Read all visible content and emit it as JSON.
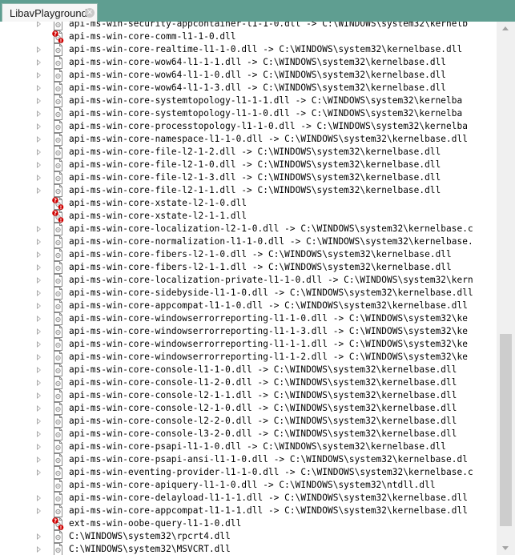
{
  "tab": {
    "title": "LibavPlayground",
    "close_glyph": "×"
  },
  "tree": {
    "items": [
      {
        "text": "api-ms-win-security-appcontainer-l1-1-0.dll -> C:\\WINDOWS\\system32\\kernelb",
        "icon": "dll-icon",
        "expandable": true
      },
      {
        "text": "api-ms-win-core-comm-l1-1-0.dll",
        "icon": "missing-dll-icon",
        "expandable": false
      },
      {
        "text": "api-ms-win-core-realtime-l1-1-0.dll -> C:\\WINDOWS\\system32\\kernelbase.dll",
        "icon": "dll-icon",
        "expandable": true
      },
      {
        "text": "api-ms-win-core-wow64-l1-1-1.dll -> C:\\WINDOWS\\system32\\kernelbase.dll",
        "icon": "dll-icon",
        "expandable": true
      },
      {
        "text": "api-ms-win-core-wow64-l1-1-0.dll -> C:\\WINDOWS\\system32\\kernelbase.dll",
        "icon": "dll-icon",
        "expandable": true
      },
      {
        "text": "api-ms-win-core-wow64-l1-1-3.dll -> C:\\WINDOWS\\system32\\kernelbase.dll",
        "icon": "dll-icon",
        "expandable": true
      },
      {
        "text": "api-ms-win-core-systemtopology-l1-1-1.dll -> C:\\WINDOWS\\system32\\kernelba",
        "icon": "dll-icon",
        "expandable": true
      },
      {
        "text": "api-ms-win-core-systemtopology-l1-1-0.dll -> C:\\WINDOWS\\system32\\kernelba",
        "icon": "dll-icon",
        "expandable": true
      },
      {
        "text": "api-ms-win-core-processtopology-l1-1-0.dll -> C:\\WINDOWS\\system32\\kernelba",
        "icon": "dll-icon",
        "expandable": true
      },
      {
        "text": "api-ms-win-core-namespace-l1-1-0.dll -> C:\\WINDOWS\\system32\\kernelbase.dll",
        "icon": "dll-icon",
        "expandable": true
      },
      {
        "text": "api-ms-win-core-file-l2-1-2.dll -> C:\\WINDOWS\\system32\\kernelbase.dll",
        "icon": "dll-icon",
        "expandable": true
      },
      {
        "text": "api-ms-win-core-file-l2-1-0.dll -> C:\\WINDOWS\\system32\\kernelbase.dll",
        "icon": "dll-icon",
        "expandable": true
      },
      {
        "text": "api-ms-win-core-file-l2-1-3.dll -> C:\\WINDOWS\\system32\\kernelbase.dll",
        "icon": "dll-icon",
        "expandable": true
      },
      {
        "text": "api-ms-win-core-file-l2-1-1.dll -> C:\\WINDOWS\\system32\\kernelbase.dll",
        "icon": "dll-icon",
        "expandable": true
      },
      {
        "text": "api-ms-win-core-xstate-l2-1-0.dll",
        "icon": "missing-dll-icon",
        "expandable": false
      },
      {
        "text": "api-ms-win-core-xstate-l2-1-1.dll",
        "icon": "missing-dll-icon",
        "expandable": false
      },
      {
        "text": "api-ms-win-core-localization-l2-1-0.dll -> C:\\WINDOWS\\system32\\kernelbase.c",
        "icon": "dll-icon",
        "expandable": true
      },
      {
        "text": "api-ms-win-core-normalization-l1-1-0.dll -> C:\\WINDOWS\\system32\\kernelbase.",
        "icon": "dll-icon",
        "expandable": true
      },
      {
        "text": "api-ms-win-core-fibers-l2-1-0.dll -> C:\\WINDOWS\\system32\\kernelbase.dll",
        "icon": "dll-icon",
        "expandable": true
      },
      {
        "text": "api-ms-win-core-fibers-l2-1-1.dll -> C:\\WINDOWS\\system32\\kernelbase.dll",
        "icon": "dll-icon",
        "expandable": true
      },
      {
        "text": "api-ms-win-core-localization-private-l1-1-0.dll -> C:\\WINDOWS\\system32\\kern",
        "icon": "dll-icon",
        "expandable": true
      },
      {
        "text": "api-ms-win-core-sidebyside-l1-1-0.dll -> C:\\WINDOWS\\system32\\kernelbase.dll",
        "icon": "dll-icon",
        "expandable": true
      },
      {
        "text": "api-ms-win-core-appcompat-l1-1-0.dll -> C:\\WINDOWS\\system32\\kernelbase.dll",
        "icon": "dll-icon",
        "expandable": true
      },
      {
        "text": "api-ms-win-core-windowserrorreporting-l1-1-0.dll -> C:\\WINDOWS\\system32\\ke",
        "icon": "dll-icon",
        "expandable": true
      },
      {
        "text": "api-ms-win-core-windowserrorreporting-l1-1-3.dll -> C:\\WINDOWS\\system32\\ke",
        "icon": "dll-icon",
        "expandable": true
      },
      {
        "text": "api-ms-win-core-windowserrorreporting-l1-1-1.dll -> C:\\WINDOWS\\system32\\ke",
        "icon": "dll-icon",
        "expandable": true
      },
      {
        "text": "api-ms-win-core-windowserrorreporting-l1-1-2.dll -> C:\\WINDOWS\\system32\\ke",
        "icon": "dll-icon",
        "expandable": true
      },
      {
        "text": "api-ms-win-core-console-l1-1-0.dll -> C:\\WINDOWS\\system32\\kernelbase.dll",
        "icon": "dll-icon",
        "expandable": true
      },
      {
        "text": "api-ms-win-core-console-l1-2-0.dll -> C:\\WINDOWS\\system32\\kernelbase.dll",
        "icon": "dll-icon",
        "expandable": true
      },
      {
        "text": "api-ms-win-core-console-l2-1-1.dll -> C:\\WINDOWS\\system32\\kernelbase.dll",
        "icon": "dll-icon",
        "expandable": true
      },
      {
        "text": "api-ms-win-core-console-l2-1-0.dll -> C:\\WINDOWS\\system32\\kernelbase.dll",
        "icon": "dll-icon",
        "expandable": true
      },
      {
        "text": "api-ms-win-core-console-l2-2-0.dll -> C:\\WINDOWS\\system32\\kernelbase.dll",
        "icon": "dll-icon",
        "expandable": true
      },
      {
        "text": "api-ms-win-core-console-l3-2-0.dll -> C:\\WINDOWS\\system32\\kernelbase.dll",
        "icon": "dll-icon",
        "expandable": true
      },
      {
        "text": "api-ms-win-core-psapi-l1-1-0.dll -> C:\\WINDOWS\\system32\\kernelbase.dll",
        "icon": "dll-icon",
        "expandable": true
      },
      {
        "text": "api-ms-win-core-psapi-ansi-l1-1-0.dll -> C:\\WINDOWS\\system32\\kernelbase.dl",
        "icon": "dll-icon",
        "expandable": true
      },
      {
        "text": "api-ms-win-eventing-provider-l1-1-0.dll -> C:\\WINDOWS\\system32\\kernelbase.c",
        "icon": "dll-icon",
        "expandable": true
      },
      {
        "text": "api-ms-win-core-apiquery-l1-1-0.dll -> C:\\WINDOWS\\system32\\ntdll.dll",
        "icon": "dll-icon",
        "expandable": false
      },
      {
        "text": "api-ms-win-core-delayload-l1-1-1.dll -> C:\\WINDOWS\\system32\\kernelbase.dll",
        "icon": "dll-icon",
        "expandable": true
      },
      {
        "text": "api-ms-win-core-appcompat-l1-1-1.dll -> C:\\WINDOWS\\system32\\kernelbase.dll",
        "icon": "dll-icon",
        "expandable": true
      },
      {
        "text": "ext-ms-win-oobe-query-l1-1-0.dll",
        "icon": "missing-dll-icon",
        "expandable": false
      },
      {
        "text": "C:\\WINDOWS\\system32\\rpcrt4.dll",
        "icon": "dll-icon",
        "expandable": true
      },
      {
        "text": "C:\\WINDOWS\\system32\\MSVCRT.dll",
        "icon": "dll-icon",
        "expandable": true
      }
    ]
  },
  "scrollbar": {
    "thumb_start": 0.59,
    "thumb_end": 0.97
  }
}
